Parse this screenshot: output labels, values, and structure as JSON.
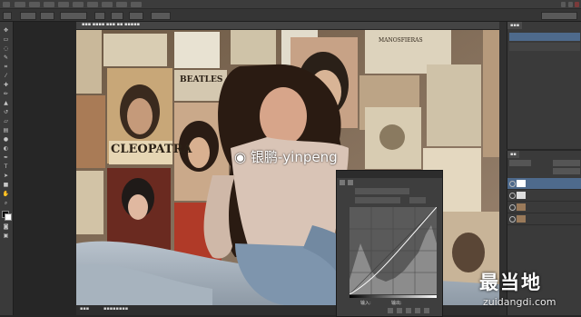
{
  "watermark": {
    "handle": "银鹏-yinpeng"
  },
  "site_logo": {
    "name": "最当地",
    "domain": "zuidangdi.com"
  },
  "posters": {
    "cleopatra": "CLEOPATRA",
    "beatles": "BEATLES",
    "manosfieras": "MANOSFIERAS"
  },
  "curves_dialog": {
    "input_label": "输入:",
    "output_label": "输出:"
  },
  "icons": [
    "move-icon",
    "marquee-icon",
    "lasso-icon",
    "crop-icon",
    "eyedropper-icon",
    "brush-icon",
    "eraser-icon",
    "type-icon",
    "hand-icon",
    "zoom-icon",
    "eye-icon"
  ],
  "colors": {
    "workspace": "#262626",
    "panel": "#3a3a3a",
    "curve_line": "#ffffff",
    "histogram": "#8c8c8c"
  }
}
